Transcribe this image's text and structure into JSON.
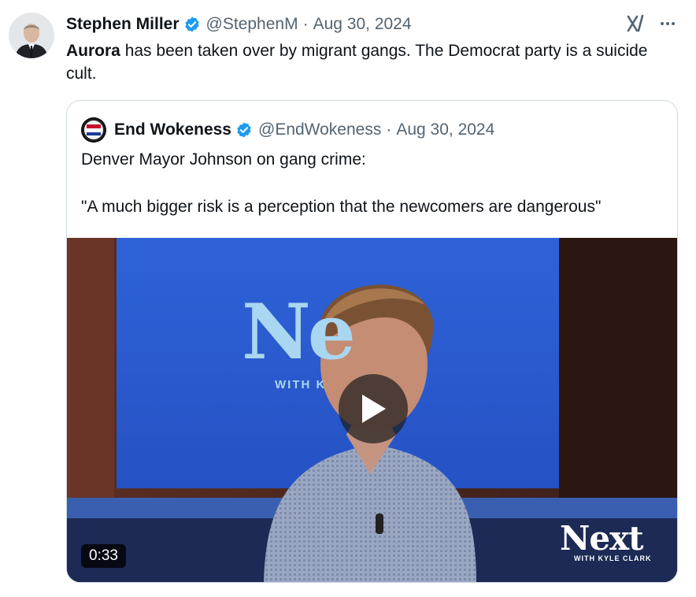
{
  "post": {
    "author_name": "Stephen Miller",
    "handle": "@StephenM",
    "separator": "·",
    "date": "Aug 30, 2024",
    "text_bold": "Aurora",
    "text_rest": " has been taken over by migrant gangs. The Democrat party is a suicide cult.",
    "avatar_icon": "profile-photo",
    "verified_color": "#1d9bf0"
  },
  "quote": {
    "author_name": "End Wokeness",
    "handle": "@EndWokeness",
    "separator": "·",
    "date": "Aug 30, 2024",
    "text": "Denver Mayor Johnson on gang crime:\n\n\"A much bigger risk is a perception that the newcomers are dangerous\""
  },
  "video": {
    "duration": "0:33",
    "background_wordmark": "Ne",
    "background_sub": "WITH K",
    "brand_wordmark": "Next",
    "brand_sub": "WITH KYLE CLARK"
  },
  "colors": {
    "text": "#0f1419",
    "secondary_text": "#536471",
    "border": "#cfd9de",
    "accent": "#1d9bf0"
  }
}
